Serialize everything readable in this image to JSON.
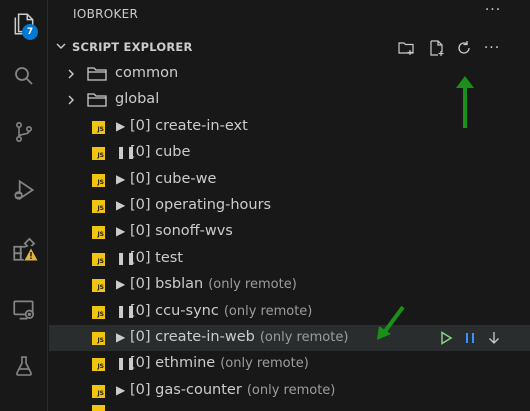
{
  "activity_bar": {
    "explorer_badge": "7",
    "icons": [
      "explorer-icon",
      "search-icon",
      "source-control-icon",
      "run-debug-icon",
      "extensions-icon",
      "remote-explorer-icon",
      "testing-icon"
    ]
  },
  "panel": {
    "title": "IOBROKER",
    "more": "···"
  },
  "section": {
    "title": "SCRIPT EXPLORER",
    "more": "···"
  },
  "folders": [
    {
      "label": "common"
    },
    {
      "label": "global"
    }
  ],
  "scripts": [
    {
      "state": "▶",
      "label": "[0] create-in-ext",
      "remote": ""
    },
    {
      "state": "❚❚",
      "label": "[0] cube",
      "remote": ""
    },
    {
      "state": "▶",
      "label": "[0] cube-we",
      "remote": ""
    },
    {
      "state": "▶",
      "label": "[0] operating-hours",
      "remote": ""
    },
    {
      "state": "▶",
      "label": "[0] sonoff-wvs",
      "remote": ""
    },
    {
      "state": "❚❚",
      "label": "[0] test",
      "remote": ""
    },
    {
      "state": "▶",
      "label": "[0] bsblan",
      "remote": "(only remote)"
    },
    {
      "state": "❚❚",
      "label": "[0] ccu-sync",
      "remote": "(only remote)"
    },
    {
      "state": "▶",
      "label": "[0] create-in-web",
      "remote": "(only remote)"
    },
    {
      "state": "❚❚",
      "label": "[0] ethmine",
      "remote": "(only remote)"
    },
    {
      "state": "▶",
      "label": "[0] gas-counter",
      "remote": "(only remote)"
    }
  ],
  "js_icon_text": "JS",
  "colors": {
    "background": "#181818",
    "selected_row": "#2a2d2e",
    "badge": "#0078d4",
    "js_icon": "#f1c40f",
    "run_action": "#89d185",
    "pause_action": "#3794ff",
    "annotation_arrow": "#1a8f1a"
  }
}
